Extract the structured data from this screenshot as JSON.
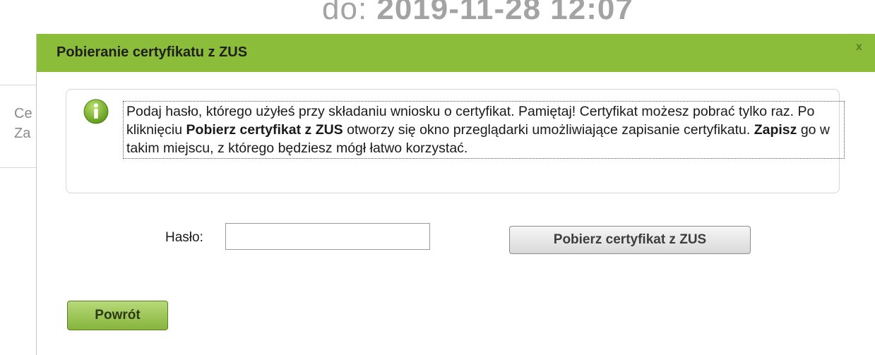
{
  "background": {
    "date_prefix": "do: ",
    "date_value": "2019-11-28 12:07",
    "side_text_1": "Ce",
    "side_text_2": "Za"
  },
  "modal": {
    "title": "Pobieranie certyfikatu z ZUS",
    "close_label": "x",
    "info": {
      "icon": "info-icon",
      "text_1": "Podaj hasło, którego użyłeś przy składaniu wniosku o certyfikat. Pamiętaj! Certyfikat możesz pobrać tylko raz. Po kliknięciu ",
      "bold_1": "Pobierz certyfikat z ZUS",
      "text_2": " otworzy się okno przeglądarki umożliwiające zapisanie certyfikatu. ",
      "bold_2": "Zapisz",
      "text_3": " go w takim miejscu, z którego będziesz mógł łatwo korzystać."
    },
    "form": {
      "password_label": "Hasło:",
      "password_value": "",
      "download_button": "Pobierz certyfikat z ZUS"
    },
    "back_button": "Powrót"
  },
  "colors": {
    "header_green": "#8bbd3a",
    "button_green": "#86b53c",
    "info_icon_green": "#7fb62d"
  }
}
